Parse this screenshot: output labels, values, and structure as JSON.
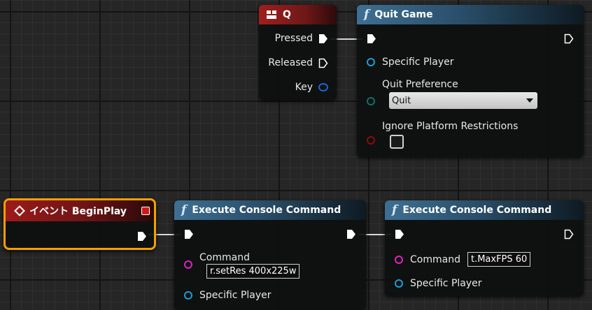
{
  "nodes": {
    "key_q": {
      "title": "Q",
      "pins": {
        "pressed": "Pressed",
        "released": "Released",
        "key": "Key"
      }
    },
    "quit_game": {
      "title": "Quit Game",
      "pins": {
        "specific_player": "Specific Player",
        "quit_preference": "Quit Preference",
        "quit_preference_value": "Quit",
        "ignore_platform_restrictions": "Ignore Platform Restrictions"
      }
    },
    "begin_play": {
      "title": "イベント BeginPlay"
    },
    "exec_cmd_1": {
      "title": "Execute Console Command",
      "pins": {
        "command": "Command",
        "command_value": "r.setRes 400x225w",
        "specific_player": "Specific Player"
      }
    },
    "exec_cmd_2": {
      "title": "Execute Console Command",
      "pins": {
        "command": "Command",
        "command_value": "t.MaxFPS 60",
        "specific_player": "Specific Player"
      }
    }
  },
  "colors": {
    "exec": "#ffffff",
    "object_pin": "#1c9cd8",
    "byte_pin": "#0b6f6f",
    "bool_pin": "#8a0b0b",
    "string_pin": "#e020c8",
    "struct_pin": "#1c64d8",
    "selection": "#f3a000"
  },
  "icons": {
    "function": "f-function-icon",
    "event": "event-diamond-icon",
    "key": "keyboard-key-icon"
  }
}
